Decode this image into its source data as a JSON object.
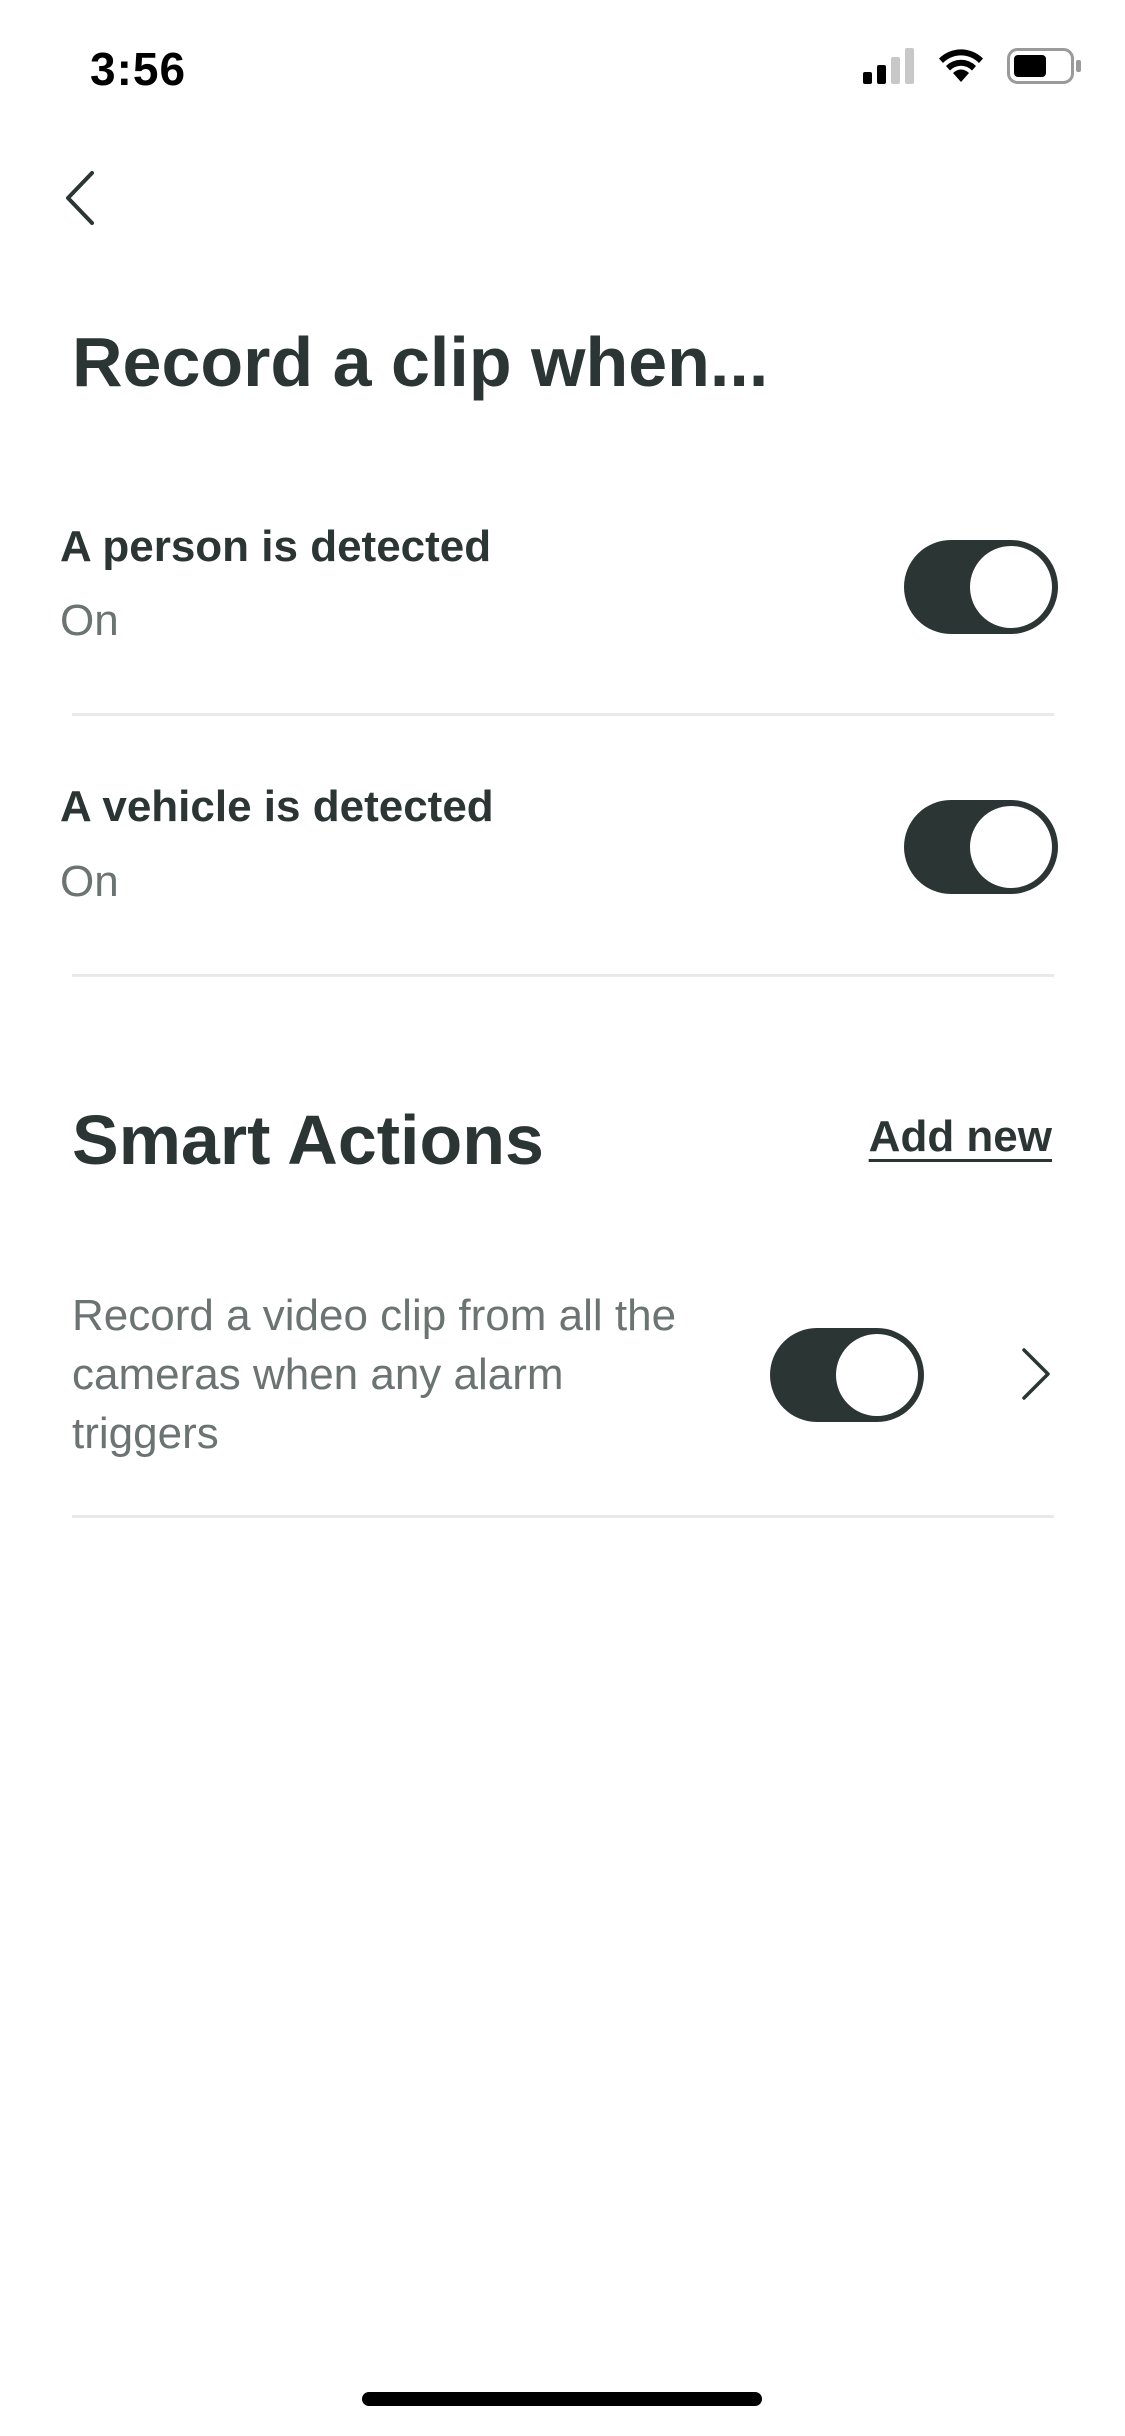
{
  "status_bar": {
    "time": "3:56"
  },
  "header": {
    "title": "Record a clip when..."
  },
  "record_settings": [
    {
      "label": "A person is detected",
      "status": "On",
      "enabled": true
    },
    {
      "label": "A vehicle is detected",
      "status": "On",
      "enabled": true
    }
  ],
  "smart_actions": {
    "title": "Smart Actions",
    "add_new_label": "Add new",
    "items": [
      {
        "description": "Record a video clip from all the cameras when any alarm triggers",
        "enabled": true
      }
    ]
  },
  "colors": {
    "text_primary": "#2b3533",
    "text_secondary": "#6b7472",
    "toggle_on": "#2b3533",
    "divider": "#e8eaea"
  },
  "icons": {
    "back": "chevron-left-icon",
    "signal": "cellular-signal-icon",
    "wifi": "wifi-icon",
    "battery": "battery-icon",
    "detail": "chevron-right-icon"
  }
}
